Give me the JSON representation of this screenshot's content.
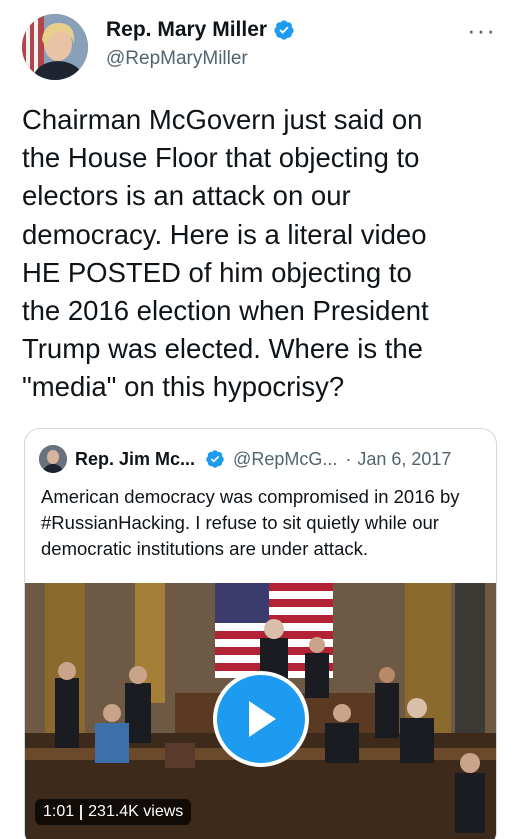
{
  "tweet": {
    "author": {
      "name": "Rep. Mary Miller",
      "handle": "@RepMaryMiller"
    },
    "more_icon": "more-horizontal-icon",
    "text": "Chairman McGovern just said on\nthe House Floor that objecting to\nelectors is an attack on our\ndemocracy. Here is a literal video\nHE POSTED of him objecting to\nthe 2016 election when President\nTrump was elected. Where is the\n\"media\" on this hypocrisy?"
  },
  "quoted_tweet": {
    "author": {
      "name": "Rep. Jim Mc...",
      "handle": "@RepMcG...",
      "separator": "·",
      "date": "Jan 6, 2017"
    },
    "text": "American democracy was compromised in 2016 by #RussianHacking. I refuse to sit quietly while our democratic institutions are under attack.",
    "video": {
      "duration": "1:01",
      "views": "231.4K views",
      "play_icon": "play-icon"
    }
  },
  "colors": {
    "accent": "#1d9bf0",
    "text_primary": "#0f1419",
    "text_secondary": "#536471",
    "border": "#cfd9de"
  }
}
